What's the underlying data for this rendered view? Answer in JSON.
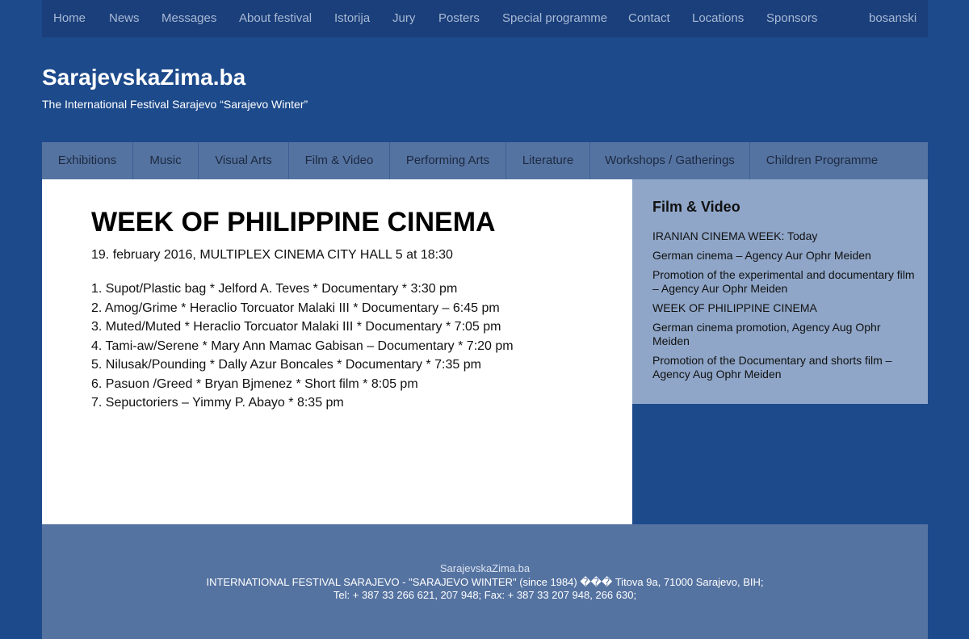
{
  "topnav": {
    "items": [
      "Home",
      "News",
      "Messages",
      "About festival",
      "Istorija",
      "Jury",
      "Posters",
      "Special programme",
      "Contact",
      "Locations",
      "Sponsors"
    ],
    "language": "bosanski"
  },
  "header": {
    "title": "SarajevskaZima.ba",
    "subtitle": "The International Festival Sarajevo “Sarajevo Winter”"
  },
  "categories": [
    "Exhibitions",
    "Music",
    "Visual Arts",
    "Film & Video",
    "Performing Arts",
    "Literature",
    "Workshops / Gatherings",
    "Children Programme"
  ],
  "article": {
    "title": "WEEK OF PHILIPPINE CINEMA",
    "date_line": "19. february 2016, MULTIPLEX CINEMA CITY HALL 5 at 18:30",
    "items": [
      "1. Supot/Plastic bag * Jelford A. Teves * Documentary * 3:30 pm",
      "2. Amog/Grime * Heraclio Torcuator Malaki III * Documentary – 6:45 pm",
      "3. Muted/Muted * Heraclio Torcuator Malaki III * Documentary * 7:05 pm",
      "4. Tami-aw/Serene * Mary Ann Mamac Gabisan – Documentary * 7:20 pm",
      "5. Nilusak/Pounding * Dally Azur Boncales * Documentary * 7:35 pm",
      "6. Pasuon /Greed * Bryan Bjmenez * Short film * 8:05 pm",
      "7. Sepuctoriers – Yimmy P. Abayo * 8:35 pm"
    ]
  },
  "sidebar": {
    "title": "Film & Video",
    "links": [
      "IRANIAN CINEMA WEEK: Today",
      "German cinema – Agency Aur Ophr Meiden",
      "Promotion of the experimental and documentary film – Agency Aur Ophr Meiden",
      "WEEK OF PHILIPPINE CINEMA",
      "German cinema promotion, Agency Aug Ophr Meiden",
      "Promotion of the Documentary and shorts film – Agency Aug Ophr Meiden"
    ]
  },
  "footer": {
    "site": "SarajevskaZima.ba",
    "line1": "INTERNATIONAL FESTIVAL SARAJEVO - \"SARAJEVO WINTER\" (since 1984) ��� Titova 9a, 71000 Sarajevo, BIH;",
    "line2": "Tel: + 387 33 266 621, 207 948; Fax: + 387 33 207 948, 266 630;"
  },
  "colors": {
    "page_bg": "#1d4a8b",
    "topnav_bg": "#1a3f7a",
    "catnav_bg": "#5573a1",
    "sidebar_bg": "#8fa6c8",
    "footer_bg": "#5573a1"
  }
}
